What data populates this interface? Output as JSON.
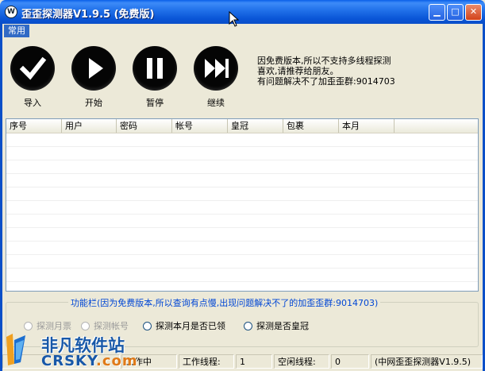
{
  "window": {
    "title": "歪歪探测器V1.9.5 (免费版)",
    "icon_letter": "W",
    "controls": [
      "minimize",
      "maximize",
      "close"
    ]
  },
  "menu": {
    "items": [
      {
        "label": "常用"
      }
    ]
  },
  "toolbar": {
    "buttons": [
      {
        "label": "导入",
        "icon": "check-icon"
      },
      {
        "label": "开始",
        "icon": "play-icon"
      },
      {
        "label": "暂停",
        "icon": "pause-icon"
      },
      {
        "label": "继续",
        "icon": "skip-forward-icon"
      }
    ]
  },
  "notice": {
    "lines": [
      "因免费版本,所以不支持多线程探测",
      "喜欢,请推荐给朋友。",
      "有问题解决不了加歪歪群:9014703"
    ]
  },
  "table": {
    "columns": [
      "序号",
      "用户",
      "密码",
      "帐号",
      "皇冠",
      "包裹",
      "本月"
    ],
    "rows": []
  },
  "function_panel": {
    "legend": "功能栏(因为免费版本,所以查询有点慢,出现问题解决不了的加歪歪群:9014703)",
    "options": [
      {
        "label": "探测月票",
        "enabled": false
      },
      {
        "label": "探测帐号",
        "enabled": false
      },
      {
        "label": "探测本月是否已领",
        "enabled": true
      },
      {
        "label": "探测是否皇冠",
        "enabled": true
      }
    ]
  },
  "status": {
    "state": "工作中",
    "work_threads_label": "工作线程:",
    "work_threads_value": "1",
    "idle_threads_label": "空闲线程:",
    "idle_threads_value": "0",
    "app_name": "(中网歪歪探测器V1.9.5)"
  },
  "watermark": {
    "cn": "非凡软件站",
    "en_main": "CRSKY",
    "en_suffix": ".com"
  },
  "colors": {
    "title_blue": "#0A5FE8",
    "selection_blue": "#316AC5",
    "window_bg": "#ECE9D8",
    "legend_text": "#0046D5"
  }
}
